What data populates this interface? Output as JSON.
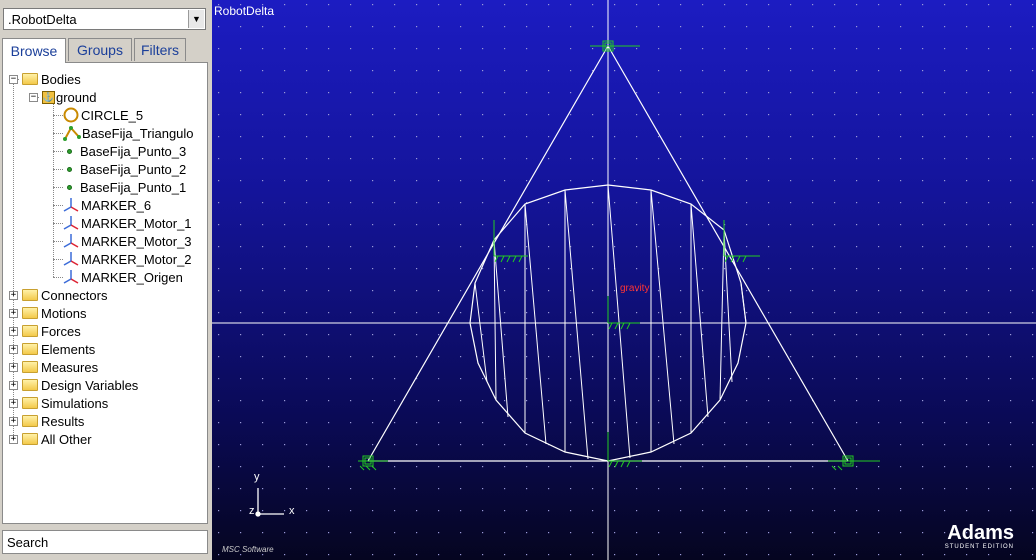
{
  "model_selector": {
    "value": ".RobotDelta"
  },
  "tabs": [
    {
      "label": "Browse",
      "active": true
    },
    {
      "label": "Groups",
      "active": false
    },
    {
      "label": "Filters",
      "active": false
    }
  ],
  "tree": {
    "bodies": "Bodies",
    "ground": "ground",
    "ground_children": [
      {
        "label": "CIRCLE_5",
        "icon": "circle-icon"
      },
      {
        "label": "BaseFija_Triangulo",
        "icon": "polyline-icon"
      },
      {
        "label": "BaseFija_Punto_3",
        "icon": "point-icon"
      },
      {
        "label": "BaseFija_Punto_2",
        "icon": "point-icon"
      },
      {
        "label": "BaseFija_Punto_1",
        "icon": "point-icon"
      },
      {
        "label": "MARKER_6",
        "icon": "marker-icon"
      },
      {
        "label": "MARKER_Motor_1",
        "icon": "marker-icon"
      },
      {
        "label": "MARKER_Motor_3",
        "icon": "marker-icon"
      },
      {
        "label": "MARKER_Motor_2",
        "icon": "marker-icon"
      },
      {
        "label": "MARKER_Origen",
        "icon": "marker-icon"
      }
    ],
    "folders": [
      "Connectors",
      "Motions",
      "Forces",
      "Elements",
      "Measures",
      "Design Variables",
      "Simulations",
      "Results",
      "All Other"
    ]
  },
  "search": {
    "placeholder": "Search"
  },
  "viewport": {
    "title": "RobotDelta",
    "gravity_label": "gravity",
    "triad": {
      "y": "y",
      "z": "z",
      "x": "x"
    },
    "logo": "Adams",
    "logo_edition": "STUDENT EDITION",
    "msc_logo": "MSC Software"
  },
  "colors": {
    "geometry": "#ffffff",
    "markers": "#22cc22",
    "gravity": "#ff3333",
    "background_top": "#1c1cc2",
    "background_bottom": "#050520"
  }
}
